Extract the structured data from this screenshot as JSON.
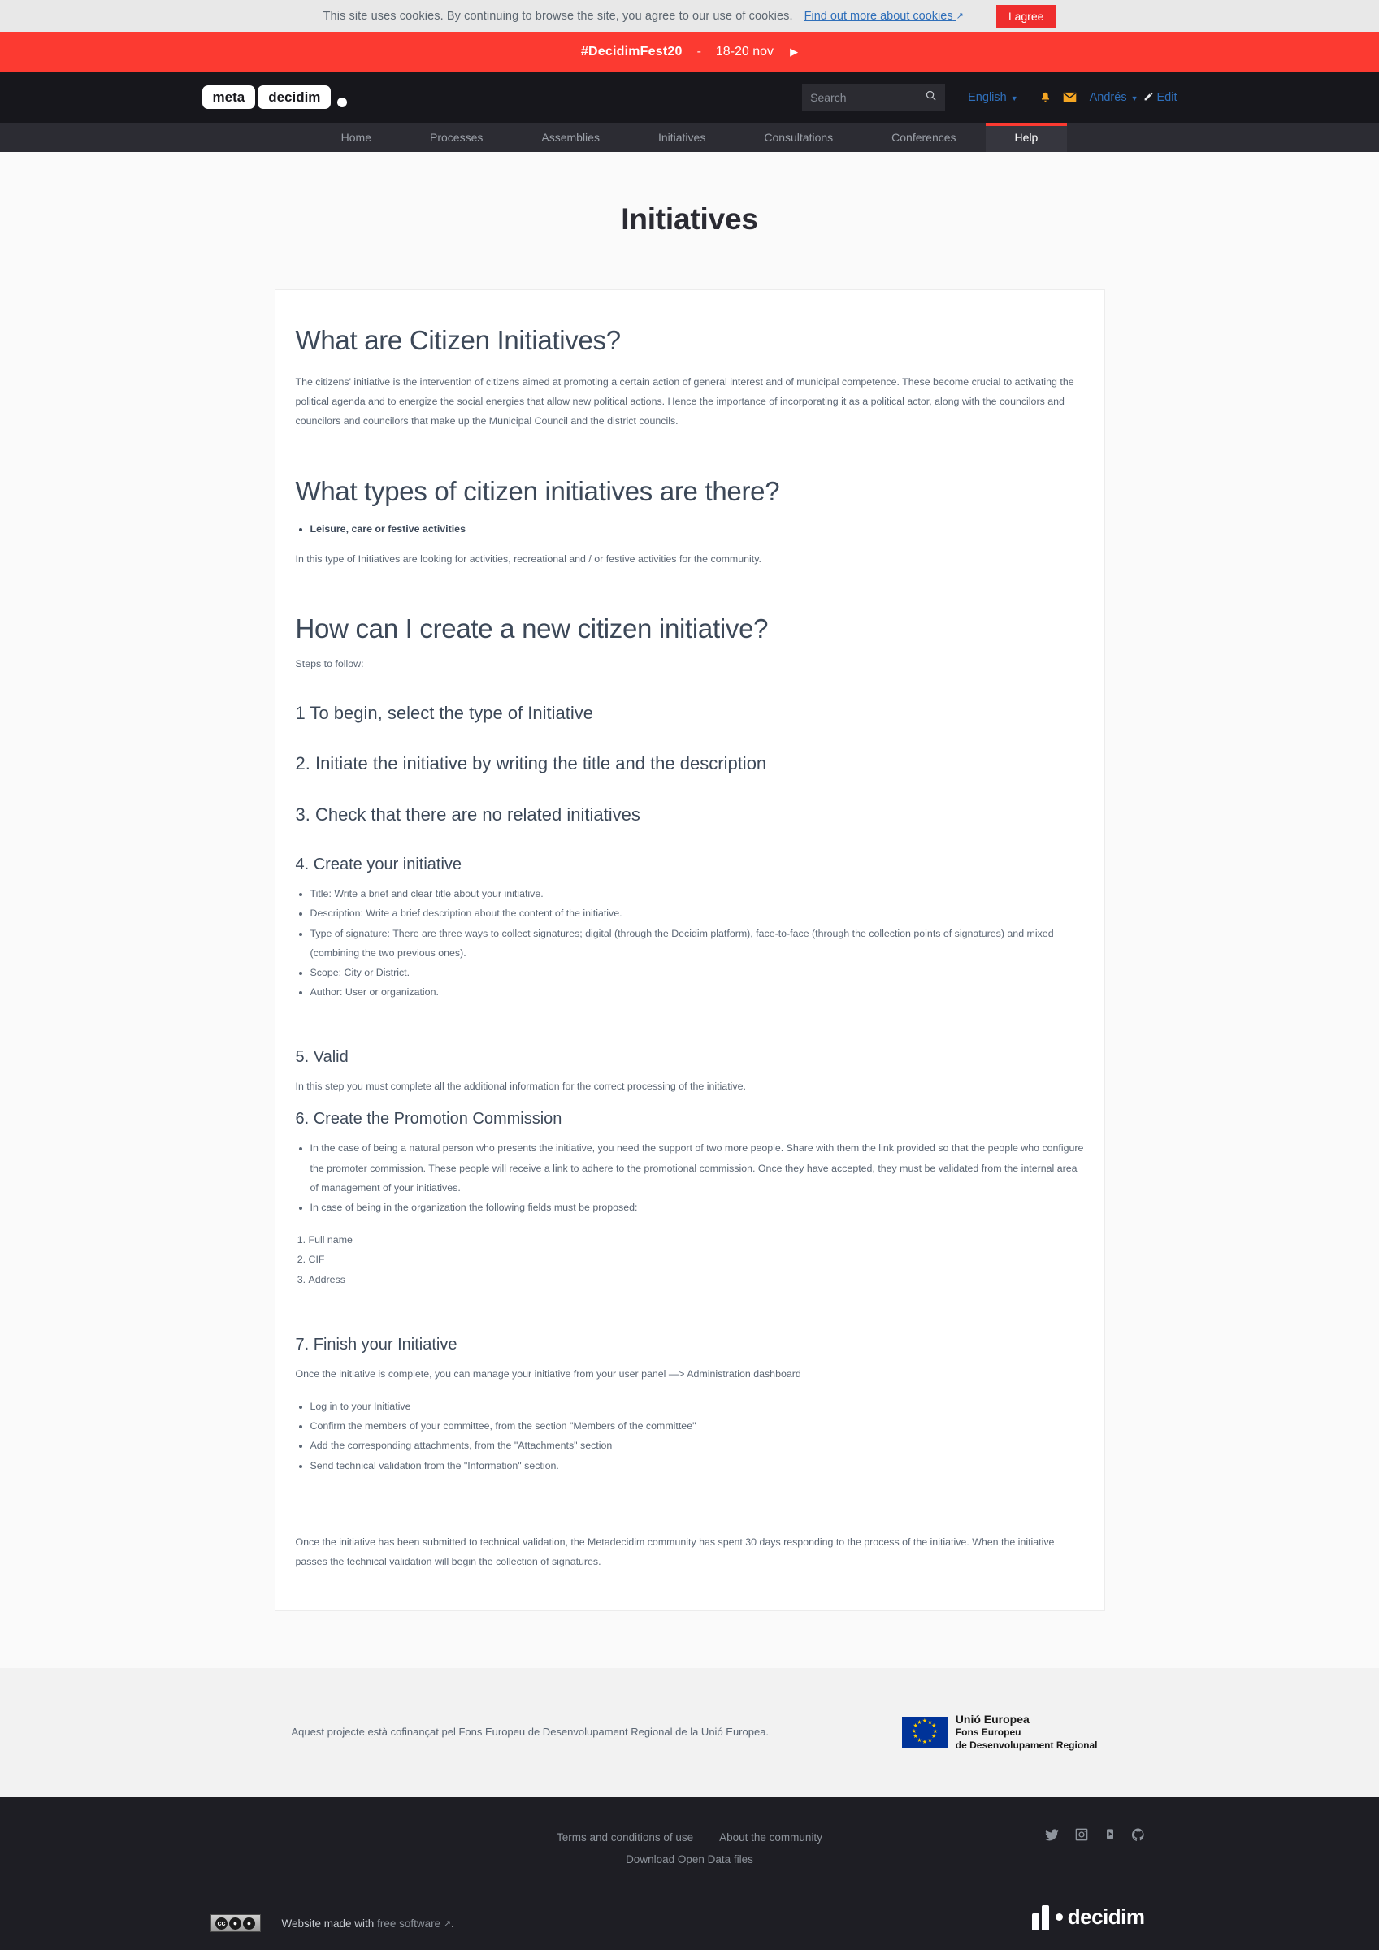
{
  "cookie": {
    "text": "This site uses cookies. By continuing to browse the site, you agree to our use of cookies.",
    "link": "Find out more about cookies",
    "accept_label": "I agree"
  },
  "promo": {
    "tag": "#DecidimFest20",
    "separator": "-",
    "date": "18-20 nov",
    "arrow": "▶"
  },
  "topbar": {
    "logo_meta": "meta",
    "logo_decidim": "decidim",
    "search_placeholder": "Search",
    "search_value": "",
    "language": "English",
    "user": "Andrés",
    "edit": "Edit"
  },
  "nav": {
    "items": [
      {
        "label": "Home",
        "active": false
      },
      {
        "label": "Processes",
        "active": false
      },
      {
        "label": "Assemblies",
        "active": false
      },
      {
        "label": "Initiatives",
        "active": false
      },
      {
        "label": "Consultations",
        "active": false
      },
      {
        "label": "Conferences",
        "active": false
      },
      {
        "label": "Help",
        "active": true
      }
    ]
  },
  "page": {
    "title": "Initiatives"
  },
  "content": {
    "s1_heading": "What are Citizen Initiatives?",
    "s1_paragraph": "The citizens' initiative is the intervention of citizens aimed at promoting a certain action of general interest and of municipal competence. These become crucial to activating the political agenda and to energize the social energies that allow new political actions. Hence the importance of incorporating it as a political actor, along with the councilors and councilors and councilors that make up the Municipal Council and the district councils.",
    "s2_heading": "What types of citizen initiatives are there?",
    "s2_bullet": "Leisure, care or festive activities",
    "s2_paragraph": "In this type of Initiatives are looking for activities, recreational and / or festive activities for the community.",
    "s3_heading": "How can I create a new citizen initiative?",
    "s3_intro": "Steps to follow:",
    "step1": "1 To begin, select the type of Initiative",
    "step2": "2. Initiate the initiative by writing the title and the description",
    "step3": "3. Check that there are no related initiatives",
    "step4_heading": "4. Create your initiative",
    "step4_bullets": [
      "Title: Write a brief and clear title about your initiative.",
      "Description: Write a brief description about the content of the initiative.",
      "Type of signature: There are three ways to collect signatures; digital (through the Decidim platform), face-to-face (through the collection points of signatures) and mixed (combining the two previous ones).",
      "Scope: City or District.",
      "Author: User or organization."
    ],
    "step5_heading": "5. Valid",
    "step5_paragraph": "In this step you must complete all the additional information for the correct processing of the initiative.",
    "step6_heading": "6. Create the Promotion Commission",
    "step6_bullets": [
      "In the case of being a natural person who presents the initiative, you need the support of two more people. Share with them the link provided so that the people who configure the promoter commission. These people will receive a link to adhere to the promotional commission. Once they have accepted, they must be validated from the internal area of management of your initiatives.",
      "In case of being in the organization the following fields must be proposed:"
    ],
    "step6_numbered": [
      "Full name",
      "CIF",
      "Address"
    ],
    "step7_heading": "7. Finish your Initiative",
    "step7_paragraph": "Once the initiative is complete, you can manage your initiative from your user panel —> Administration dashboard",
    "step7_bullets": [
      "Log in to your Initiative",
      "Confirm the members of your committee, from the section \"Members of the committee\"",
      "Add the corresponding attachments, from the \"Attachments\" section",
      "Send technical validation from the \"Information\" section."
    ],
    "closing_paragraph": "Once the initiative has been submitted to technical validation, the Metadecidim community has spent 30 days responding to the process of the initiative. When the initiative passes the technical validation will begin the collection of signatures."
  },
  "eu": {
    "text": "Aquest projecte està cofinançat pel Fons Europeu de Desenvolupament Regional de la Unió Europea.",
    "line1": "Unió Europea",
    "line2": "Fons Europeu",
    "line3": "de Desenvolupament Regional"
  },
  "footer": {
    "links": [
      "Terms and conditions of use",
      "About the community",
      "Download Open Data files"
    ],
    "made_with_prefix": "Website made with",
    "made_with_link": "free software",
    "made_with_suffix": ".",
    "brand": "decidim"
  },
  "colors": {
    "promo_red": "#fc3a31",
    "accent_link": "#2f6fba",
    "dark_bg": "#17171c",
    "nav_bg": "#2c2c33",
    "notif_orange": "#f5a623"
  }
}
